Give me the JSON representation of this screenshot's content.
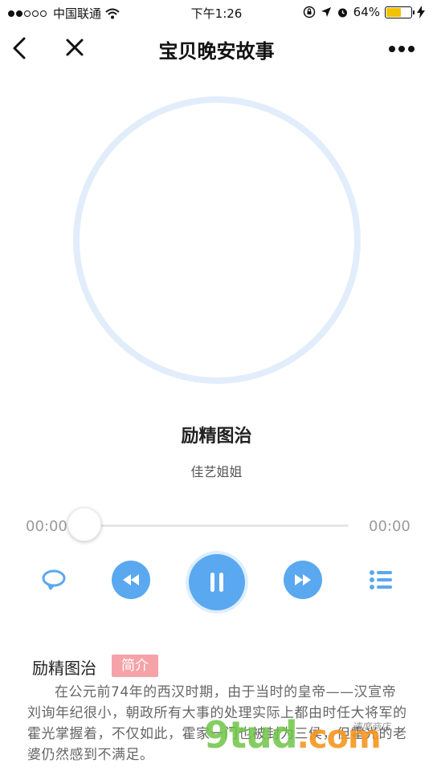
{
  "status_bar": {
    "carrier": "中国联通",
    "time": "下午1:26",
    "battery_percent": "64%",
    "battery_level": 0.64,
    "signal_bars_filled": 2,
    "signal_bars_total": 5,
    "battery_color": "#f3c200"
  },
  "nav": {
    "title": "宝贝晚安故事",
    "back_icon": "chevron-left-icon",
    "close_icon": "close-icon",
    "more_icon": "more-dots-icon"
  },
  "player": {
    "track_title": "励精图治",
    "artist": "佳艺姐姐",
    "current_time": "00:00",
    "total_time": "00:00",
    "progress": 0,
    "accent_color": "#5aa8ef",
    "controls": [
      "loop-icon",
      "rewind-icon",
      "pause-icon",
      "fast-forward-icon",
      "playlist-icon"
    ]
  },
  "description": {
    "title": "励精图治",
    "badge": "简介",
    "badge_color": "#f5a3a8",
    "text": "在公元前74年的西汉时期，由于当时的皇帝——汉宣帝刘询年纪很小，朝政所有大事的处理实际上都由时任大将军的霍光掌握着，不仅如此，霍家一门也被封为三侯，但霍光的老婆仍然感到不满足。"
  },
  "watermark": {
    "main": "9tud",
    "suffix": ".com",
    "small": "速度商店"
  }
}
